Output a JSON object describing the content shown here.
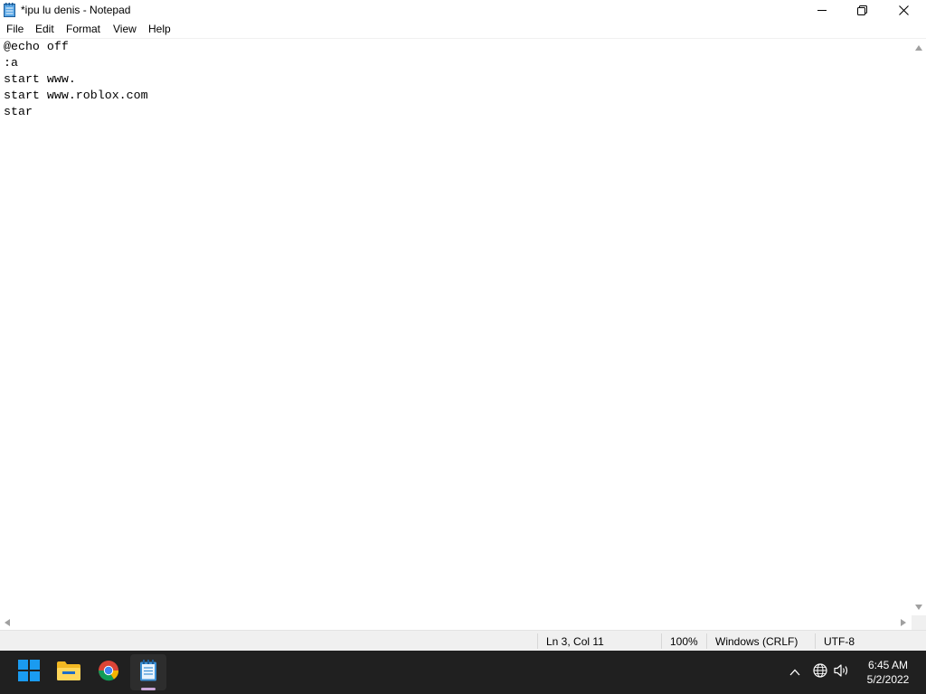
{
  "window": {
    "title": "*ipu lu denis - Notepad",
    "app_icon": "notepad-icon"
  },
  "title_buttons": {
    "minimize_icon": "minimize-icon",
    "maximize_icon": "restore-icon",
    "close_icon": "close-icon"
  },
  "menu": {
    "items": [
      "File",
      "Edit",
      "Format",
      "View",
      "Help"
    ]
  },
  "editor": {
    "lines": [
      "@echo off",
      ":a",
      "start www.",
      "start www.roblox.com",
      "star"
    ]
  },
  "statusbar": {
    "position": "Ln 3, Col 11",
    "zoom": "100%",
    "line_ending": "Windows (CRLF)",
    "encoding": "UTF-8"
  },
  "taskbar": {
    "apps": [
      "start-icon",
      "file-explorer-icon",
      "chrome-icon",
      "notepad-icon"
    ],
    "tray": [
      "chevron-up-icon",
      "globe-icon",
      "speaker-icon"
    ],
    "clock": {
      "time": "6:45 AM",
      "date": "5/2/2022"
    }
  },
  "colors": {
    "taskbar_bg": "#202020",
    "statusbar_bg": "#f0f0f0",
    "start_accent": "#1a9bf0",
    "notepad_accent": "#3b8fd4"
  }
}
